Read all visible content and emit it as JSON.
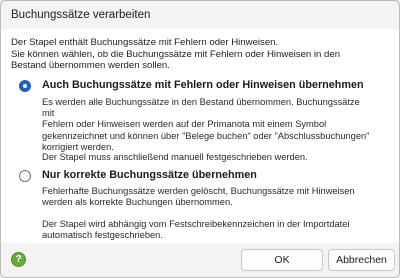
{
  "dialog": {
    "title": "Buchungssätze verarbeiten",
    "intro_line1": "Der Stapel enthält Buchungssätze mit Fehlern oder Hinweisen.",
    "intro_line2": "Sie können wählen, ob die Buchungssätze mit Fehlern oder Hinweisen in den",
    "intro_line3": "Bestand übernommen werden sollen."
  },
  "options": [
    {
      "label": "Auch Buchungssätze mit Fehlern oder Hinweisen übernehmen",
      "selected": true,
      "desc_line1": "Es werden alle Buchungssätze in den Bestand übernommen. Buchungssätze mit",
      "desc_line2": "Fehlern oder Hinweisen werden auf der Primanota mit einem Symbol",
      "desc_line3": "gekennzeichnet und können über \"Belege buchen\" oder \"Abschlussbuchungen\"",
      "desc_line4": "korrigiert werden.",
      "note": "Der Stapel muss anschließend manuell festgeschrieben werden."
    },
    {
      "label": "Nur korrekte Buchungssätze übernehmen",
      "selected": false,
      "desc_line1": "Fehlerhafte Buchungssätze werden gelöscht, Buchungssätze mit Hinweisen",
      "desc_line2": "werden als korrekte Buchungen übernommen.",
      "note_line1": "Der Stapel wird abhängig vom Festschreibekennzeichen in der Importdatei",
      "note_line2": "automatisch festgeschrieben."
    }
  ],
  "footer": {
    "help_glyph": "?",
    "ok_label": "OK",
    "cancel_label": "Abbrechen"
  },
  "colors": {
    "accent": "#1f5fbf",
    "help": "#6aa83a"
  },
  "icons": {
    "help": "help-icon"
  }
}
